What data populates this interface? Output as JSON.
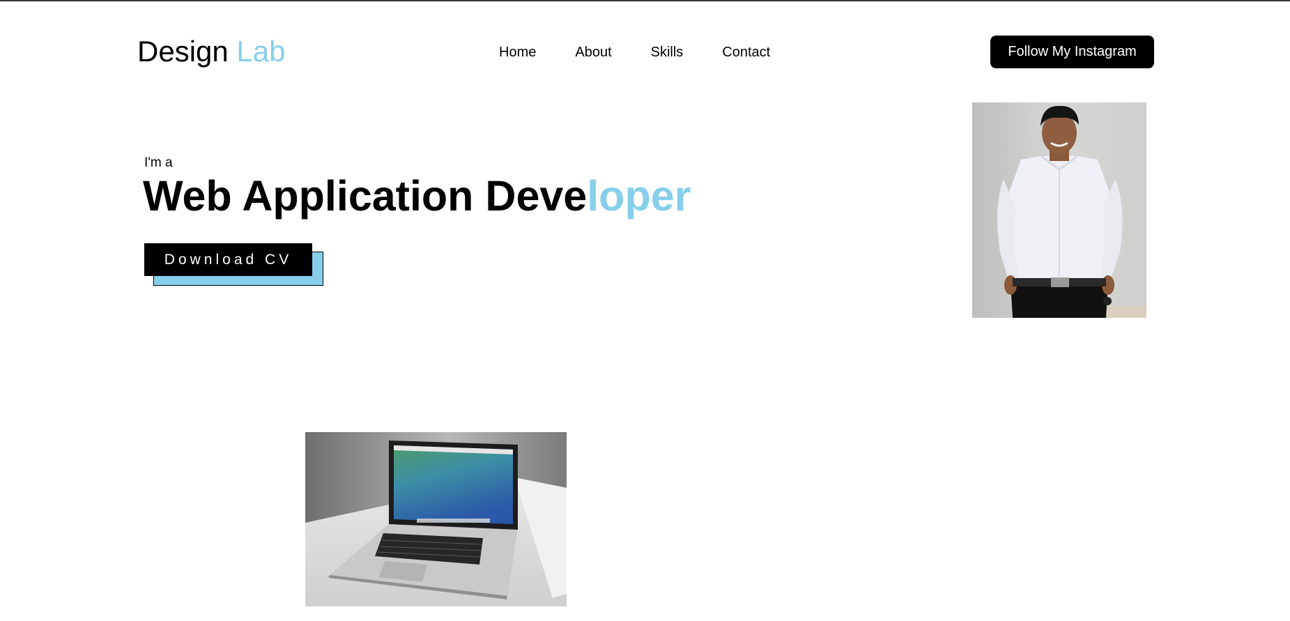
{
  "header": {
    "logo": {
      "primary": "Design",
      "accent": "Lab"
    },
    "nav": [
      {
        "label": "Home"
      },
      {
        "label": "About"
      },
      {
        "label": "Skills"
      },
      {
        "label": "Contact"
      }
    ],
    "cta_label": "Follow My Instagram"
  },
  "hero": {
    "intro": "I'm a",
    "headline_main": "Web Application Deve",
    "headline_accent": "loper",
    "download_label": "Download CV"
  },
  "colors": {
    "accent": "#87ceeb",
    "text": "#000000",
    "button_bg": "#000000",
    "button_text": "#ffffff"
  },
  "images": {
    "portrait": "profile-photo",
    "laptop": "laptop-photo"
  }
}
